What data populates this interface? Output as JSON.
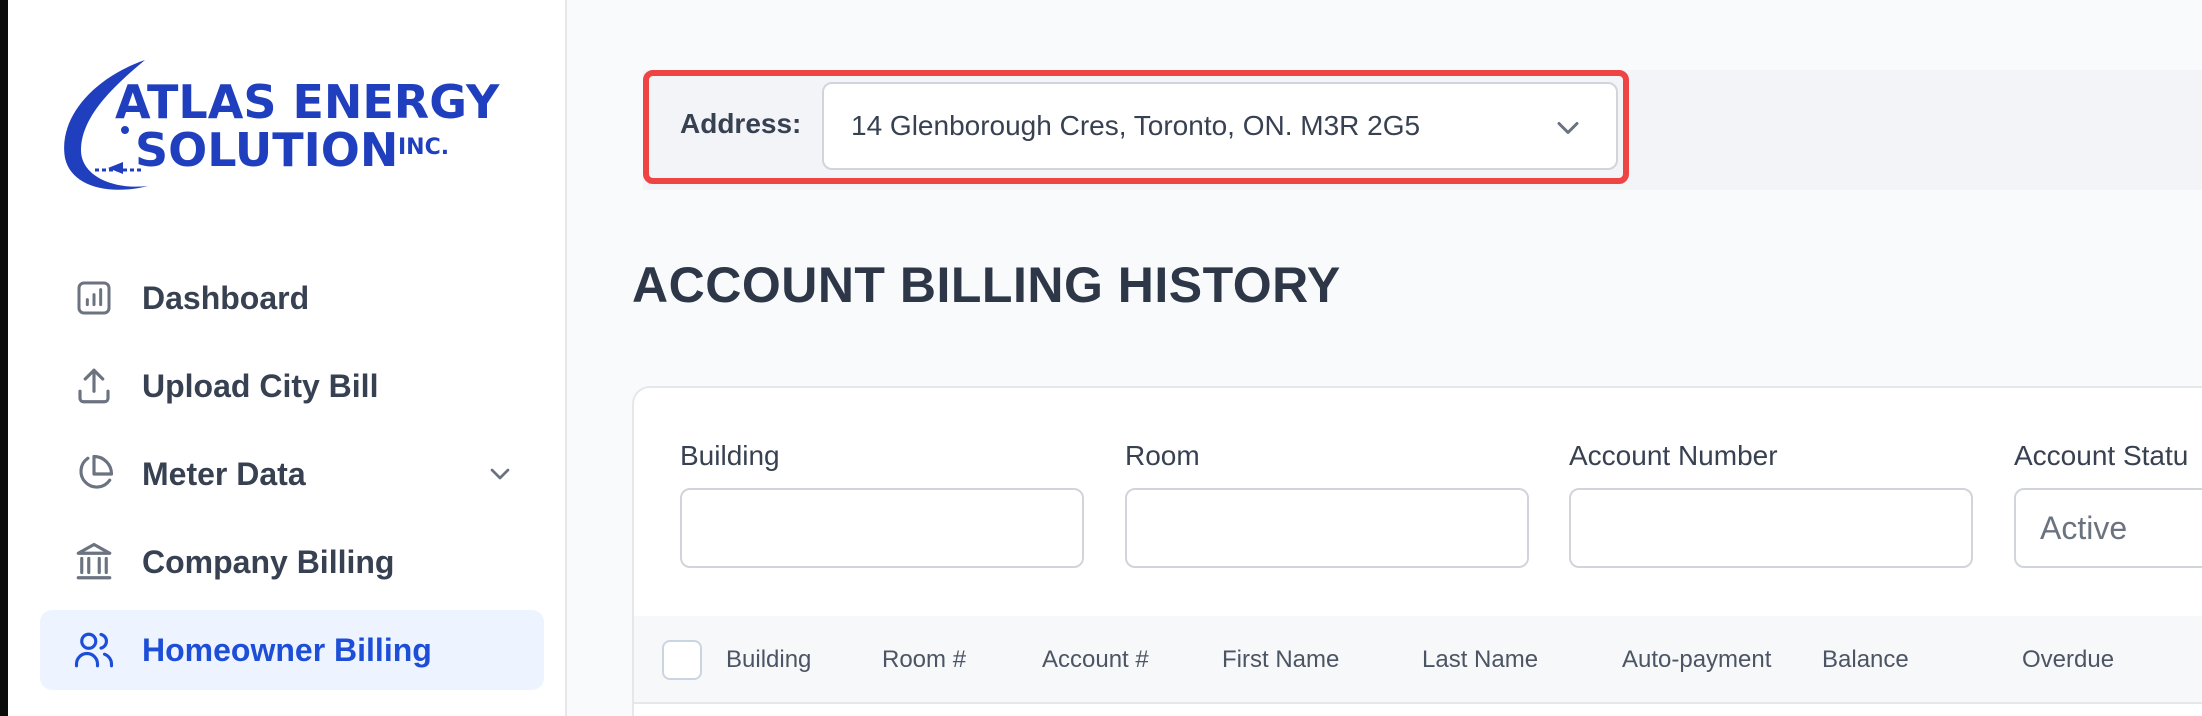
{
  "brand": {
    "line1": "ATLAS ENERGY",
    "line2": "SOLUTION",
    "suffix": "INC."
  },
  "sidebar": {
    "items": [
      {
        "label": "Dashboard",
        "icon": "bar-chart-icon"
      },
      {
        "label": "Upload City Bill",
        "icon": "upload-icon"
      },
      {
        "label": "Meter Data",
        "icon": "pie-chart-icon",
        "expandable": true
      },
      {
        "label": "Company Billing",
        "icon": "bank-icon"
      },
      {
        "label": "Homeowner Billing",
        "icon": "users-icon",
        "active": true
      }
    ]
  },
  "address": {
    "label": "Address:",
    "value": "14 Glenborough Cres, Toronto, ON. M3R 2G5"
  },
  "page": {
    "title": "ACCOUNT BILLING HISTORY"
  },
  "filters": {
    "building_label": "Building",
    "room_label": "Room",
    "account_number_label": "Account Number",
    "account_status_label": "Account Statu",
    "account_status_value": "Active"
  },
  "table": {
    "columns": [
      "Building",
      "Room #",
      "Account #",
      "First Name",
      "Last Name",
      "Auto-payment",
      "Balance",
      "Overdue"
    ]
  },
  "colors": {
    "accent": "#1d4ed8",
    "highlight": "#ef4444",
    "logo_blue": "#1f3fbf"
  }
}
